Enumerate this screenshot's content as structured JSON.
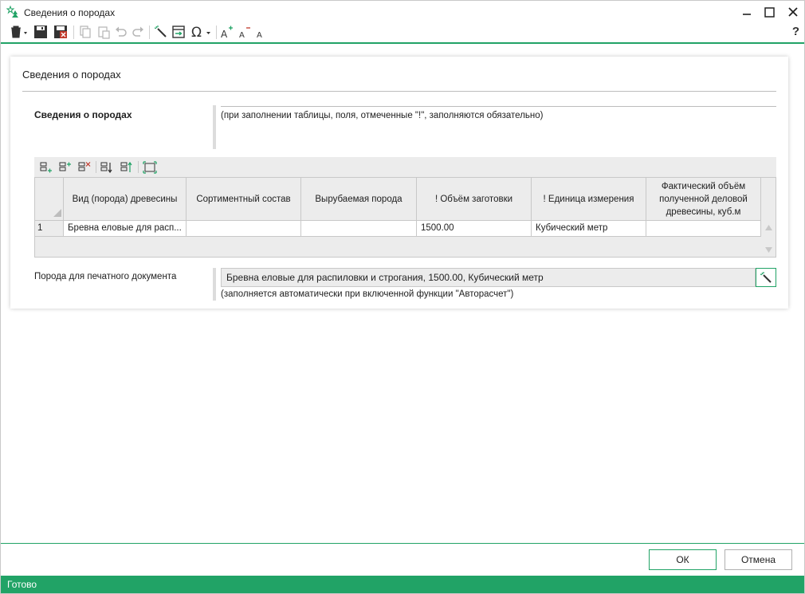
{
  "window": {
    "title": "Сведения о породах"
  },
  "toolbar": {
    "icons": [
      "trash-icon",
      "save-icon",
      "save-close-icon",
      "copy-icon",
      "paste-icon",
      "undo-icon",
      "redo-icon",
      "wand-icon",
      "import-icon",
      "omega-icon",
      "font-increase-icon",
      "font-decrease-icon",
      "font-reset-icon"
    ],
    "help_label": "?"
  },
  "panel": {
    "title": "Сведения о породах",
    "section_label": "Сведения о породах",
    "section_note": "(при заполнении таблицы, поля, отмеченные \"!\", заполняются обязательно)"
  },
  "grid": {
    "columns": [
      "Вид (порода) древесины",
      "Сортиментный состав",
      "Вырубаемая порода",
      "! Объём заготовки",
      "! Единица измерения",
      "Фактический объём полученной деловой древесины, куб.м"
    ],
    "rows": [
      {
        "num": "1",
        "cells": [
          "Бревна еловые для расп...",
          "",
          "",
          "1500.00",
          "Кубический метр",
          ""
        ]
      }
    ]
  },
  "print": {
    "label": "Порода для печатного документа",
    "value": "Бревна еловые для распиловки и строгания, 1500.00, Кубический метр",
    "note": "(заполняется автоматически при включенной функции \"Авторасчет\")"
  },
  "footer": {
    "ok_label": "ОК",
    "cancel_label": "Отмена"
  },
  "status": {
    "text": "Готово"
  },
  "colors": {
    "accent": "#21a366"
  }
}
